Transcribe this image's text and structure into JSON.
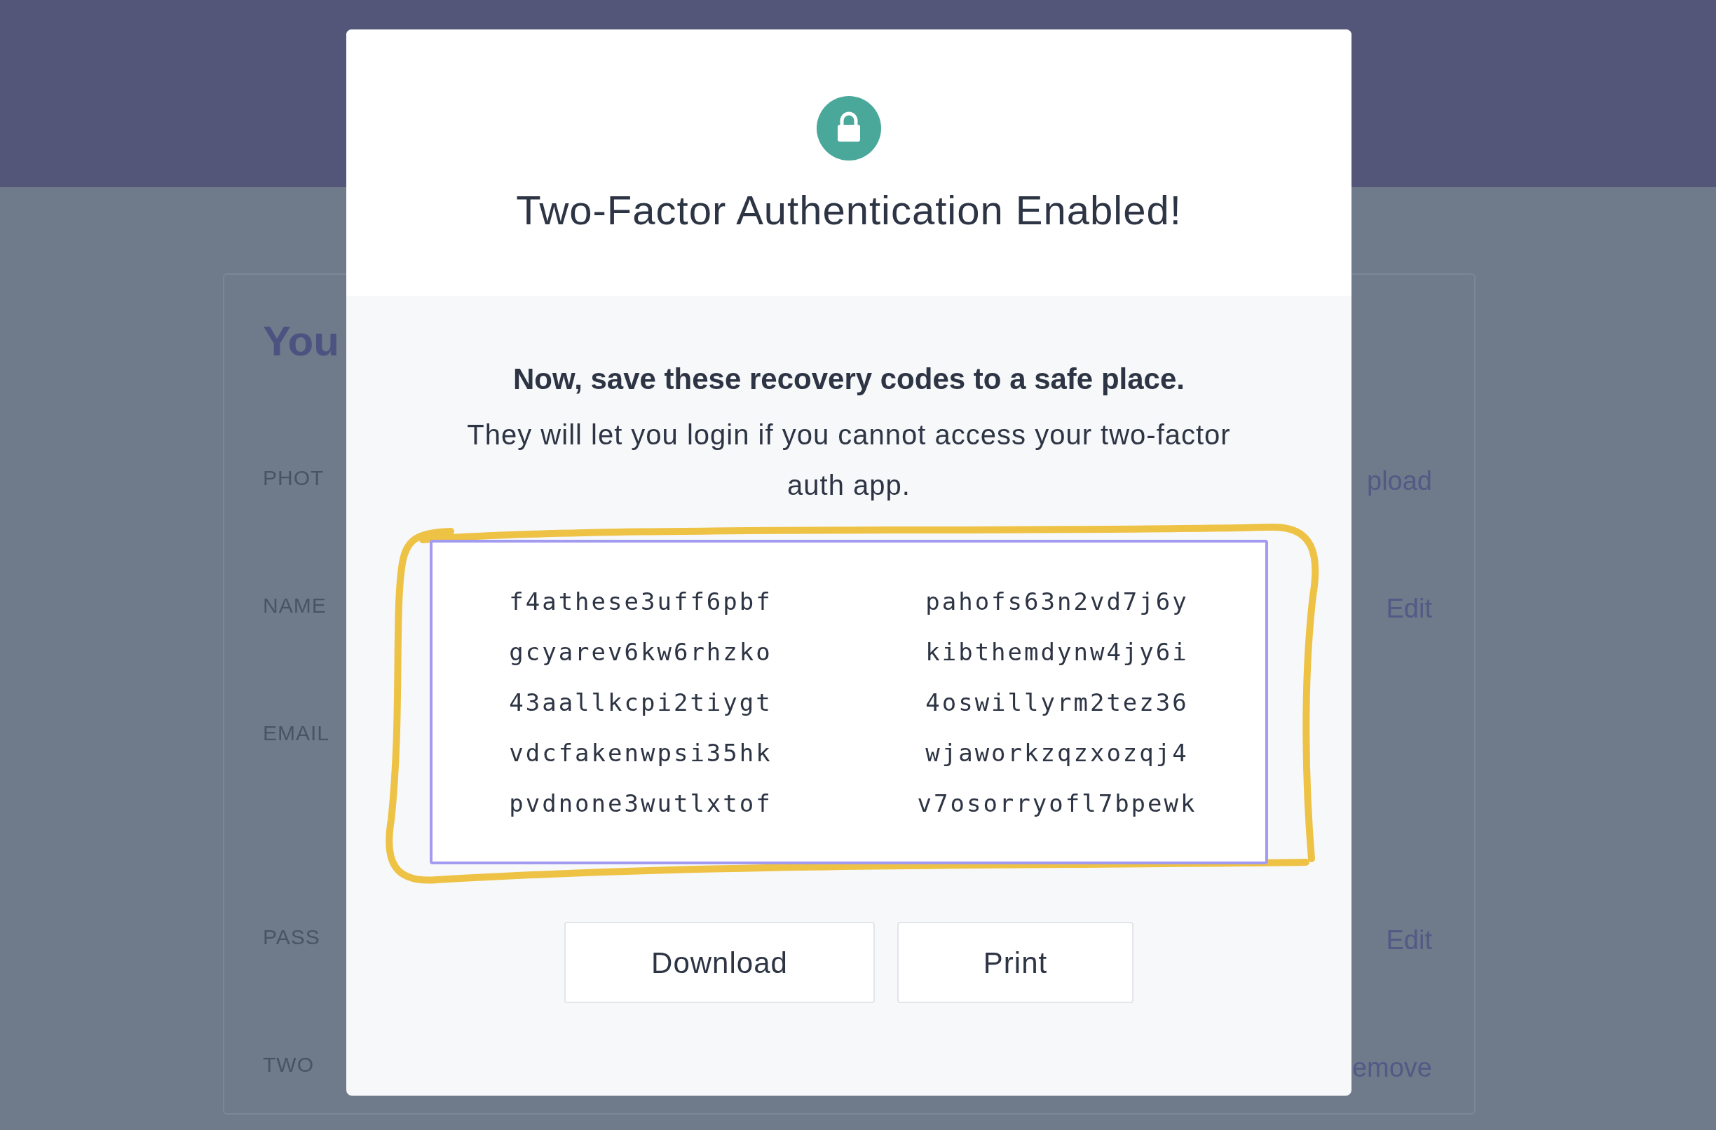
{
  "background": {
    "heading": "You",
    "rows": [
      {
        "label": "PHOT",
        "action": "pload"
      },
      {
        "label": "NAME",
        "action": "Edit"
      },
      {
        "label": "EMAIL"
      },
      {
        "label": "PASS",
        "action": "Edit"
      },
      {
        "label": "TWO",
        "action": "emove"
      }
    ]
  },
  "modal": {
    "title": "Two-Factor Authentication Enabled!",
    "lead": "Now, save these recovery codes to a safe place.",
    "text": "They will let you login if you cannot access your two-factor auth app.",
    "codes": [
      [
        "f4athese3uff6pbf",
        "pahofs63n2vd7j6y"
      ],
      [
        "gcyarev6kw6rhzko",
        "kibthemdynw4jy6i"
      ],
      [
        "43aallkcpi2tiygt",
        "4oswillyrm2tez36"
      ],
      [
        "vdcfakenwpsi35hk",
        "wjaworkzqzxozqj4"
      ],
      [
        "pvdnone3wutlxtof",
        "v7osorryofl7bpewk"
      ]
    ],
    "buttons": [
      "Download",
      "Print"
    ]
  }
}
